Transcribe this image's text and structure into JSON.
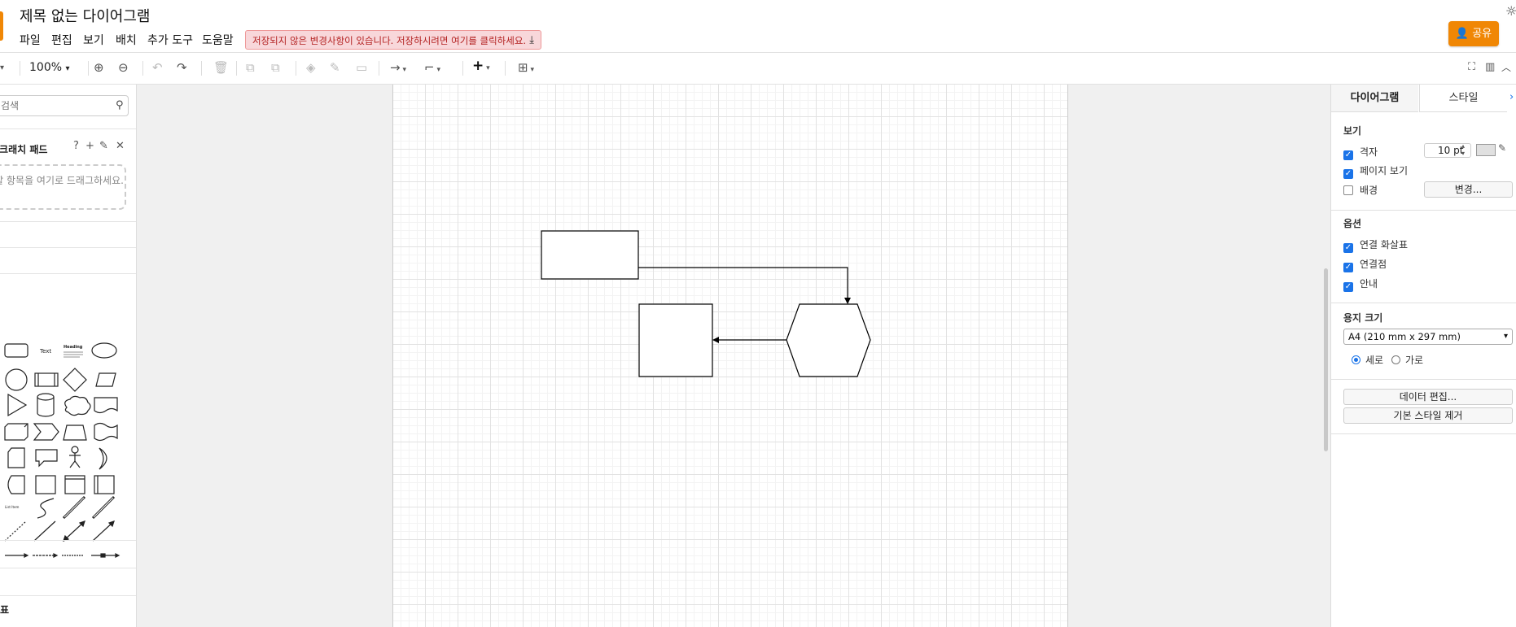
{
  "header": {
    "title": "제목 없는 다이어그램",
    "menu": [
      "파일",
      "편집",
      "보기",
      "배치",
      "추가 도구",
      "도움말"
    ],
    "unsaved_notice": "저장되지 않은 변경사항이 있습니다. 저장하시려면 여기를 클릭하세요.",
    "share_label": "공유",
    "icons": {
      "download": "download-icon",
      "user": "user-icon",
      "theme": "sun-icon"
    }
  },
  "toolbar": {
    "zoom": "100%",
    "icons": [
      "zoom-in-icon",
      "zoom-out-icon",
      "undo-icon",
      "redo-icon",
      "delete-icon",
      "to-front-icon",
      "to-back-icon",
      "fill-color-icon",
      "line-color-icon",
      "shadow-icon",
      "connection-icon",
      "waypoints-icon",
      "insert-icon",
      "table-icon",
      "fullscreen-icon",
      "format-panel-icon",
      "collapse-icon"
    ]
  },
  "sidebar": {
    "search_placeholder": "검색",
    "scratchpad_title": "스크래치 패드",
    "scratchpad_actions": [
      "?",
      "+",
      "✎",
      "✕"
    ],
    "scratchpad_drop_text": "저장할 항목을 여기로 드래그하세요.",
    "shape_texts": {
      "text": "Text",
      "heading": "Heading",
      "list_item": "List Item"
    },
    "bottom_label": "표"
  },
  "format_panel": {
    "tabs": [
      "다이어그램",
      "스타일"
    ],
    "view_section": "보기",
    "grid_label": "격자",
    "grid_checked": true,
    "grid_size": "10 pt",
    "page_view_label": "페이지 보기",
    "page_view_checked": true,
    "background_label": "배경",
    "background_checked": false,
    "change_button": "변경...",
    "options_section": "옵션",
    "options": [
      {
        "label": "연결 화살표",
        "checked": true
      },
      {
        "label": "연결점",
        "checked": true
      },
      {
        "label": "안내",
        "checked": true
      }
    ],
    "paper_section": "용지 크기",
    "paper_size": "A4 (210 mm x 297 mm)",
    "orientation": {
      "portrait": "세로",
      "landscape": "가로",
      "selected": "portrait"
    },
    "edit_data_button": "데이터 편집...",
    "clear_style_button": "기본 스타일 제거"
  },
  "colors": {
    "accent": "#f08705",
    "link_blue": "#1a73e8",
    "warning_bg": "#f8d7da",
    "warning_text": "#b32020"
  }
}
